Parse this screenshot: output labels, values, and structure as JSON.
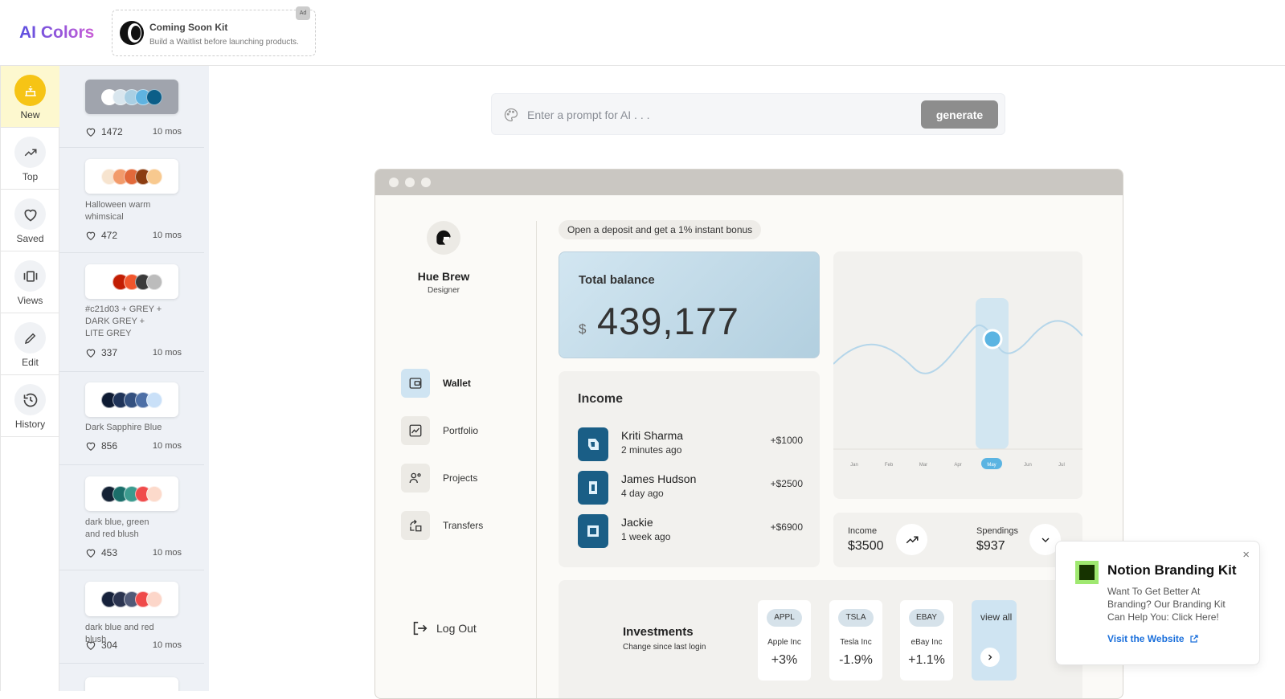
{
  "header": {
    "logo": "AI Colors",
    "ad": {
      "title": "Coming Soon Kit",
      "subtitle": "Build a Waitlist before launching products.",
      "tag": "Ad"
    }
  },
  "rail": {
    "items": [
      {
        "label": "New",
        "icon": "cake-icon",
        "active": true
      },
      {
        "label": "Top",
        "icon": "trending-up-icon"
      },
      {
        "label": "Saved",
        "icon": "heart-icon"
      },
      {
        "label": "Views",
        "icon": "views-icon"
      },
      {
        "label": "Edit",
        "icon": "pencil-icon"
      },
      {
        "label": "History",
        "icon": "history-icon"
      }
    ]
  },
  "palettes": [
    {
      "name": "",
      "likes": "1472",
      "age": "10 mos",
      "colors": [
        "#ffffff",
        "#d9e6ee",
        "#a9cfe3",
        "#5fb3e0",
        "#0c5e88"
      ]
    },
    {
      "name": "Halloween warm whimsical",
      "likes": "472",
      "age": "10 mos",
      "colors": [
        "#f7e4cf",
        "#f29b6b",
        "#e2693a",
        "#8c3d11",
        "#f8c98f"
      ]
    },
    {
      "name": "#c21d03 + GREY + DARK GREY + LITE GREY",
      "likes": "337",
      "age": "10 mos",
      "colors": [
        "#ffffff",
        "#c21d03",
        "#f0552c",
        "#3a3a3a",
        "#bcbcbc"
      ]
    },
    {
      "name": "Dark Sapphire Blue",
      "likes": "856",
      "age": "10 mos",
      "colors": [
        "#0e1b33",
        "#1f3358",
        "#34507f",
        "#4d6fa6",
        "#c9e0f8"
      ]
    },
    {
      "name": "dark blue, green and red blush",
      "likes": "453",
      "age": "10 mos",
      "colors": [
        "#142235",
        "#1b6e6a",
        "#3c9b8f",
        "#f04b4b",
        "#fcdacb"
      ]
    },
    {
      "name": "dark blue and red blush",
      "likes": "304",
      "age": "10 mos",
      "colors": [
        "#16213b",
        "#2b3450",
        "#515a78",
        "#ef4a4a",
        "#fcd6c9"
      ]
    }
  ],
  "prompt": {
    "placeholder": "Enter a prompt for AI . . .",
    "button": "generate"
  },
  "mockup": {
    "user": {
      "name": "Hue Brew",
      "role": "Designer"
    },
    "nav": [
      {
        "label": "Wallet",
        "active": true
      },
      {
        "label": "Portfolio"
      },
      {
        "label": "Projects"
      },
      {
        "label": "Transfers"
      }
    ],
    "logout": "Log Out",
    "promo": "Open a deposit and get a 1% instant bonus",
    "balance": {
      "title": "Total balance",
      "currency": "$",
      "value": "439,177"
    },
    "income": {
      "title": "Income",
      "rows": [
        {
          "name": "Kriti Sharma",
          "time": "2 minutes ago",
          "amount": "+$1000"
        },
        {
          "name": "James Hudson",
          "time": "4 day ago",
          "amount": "+$2500"
        },
        {
          "name": "Jackie",
          "time": "1 week ago",
          "amount": "+$6900"
        }
      ]
    },
    "chart": {
      "months": [
        "Jan",
        "Feb",
        "Mar",
        "Apr",
        "May",
        "Jun",
        "Jul"
      ],
      "selected": "May"
    },
    "stats": {
      "income_label": "Income",
      "income_value": "$3500",
      "spend_label": "Spendings",
      "spend_value": "$937"
    },
    "investments": {
      "title": "Investments",
      "subtitle": "Change since last login",
      "stocks": [
        {
          "ticker": "APPL",
          "name": "Apple Inc",
          "change": "+3%"
        },
        {
          "ticker": "TSLA",
          "name": "Tesla Inc",
          "change": "-1.9%"
        },
        {
          "ticker": "EBAY",
          "name": "eBay Inc",
          "change": "+1.1%"
        }
      ],
      "view_all": "view all"
    }
  },
  "popup": {
    "title": "Notion Branding Kit",
    "body": "Want To Get Better At Branding? Our Branding Kit Can Help You: Click Here!",
    "link": "Visit the Website",
    "close": "×"
  },
  "colors": {
    "accent": "#f6c415",
    "active_bg": "#fdf8cf",
    "link": "#1a6fdb",
    "balance_card": "#c4dcea"
  }
}
